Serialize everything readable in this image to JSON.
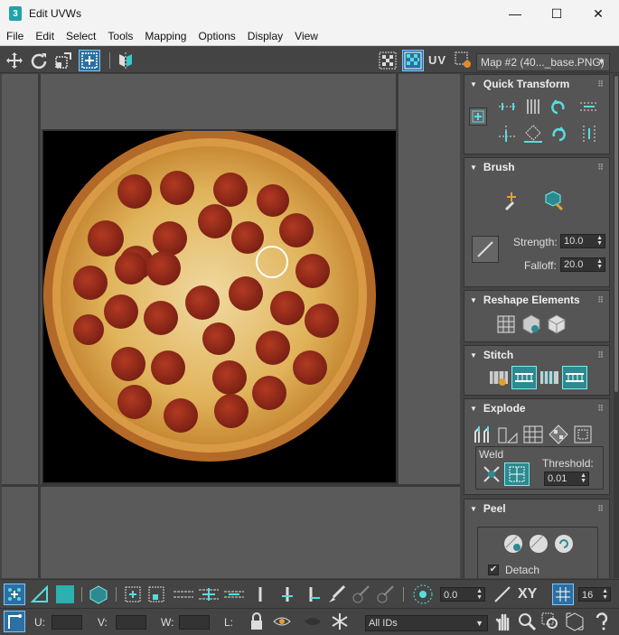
{
  "window": {
    "title": "Edit UVWs",
    "app_icon_text": "3",
    "minimize": "—",
    "maximize": "☐",
    "close": "✕"
  },
  "menu": [
    "File",
    "Edit",
    "Select",
    "Tools",
    "Mapping",
    "Options",
    "Display",
    "View"
  ],
  "toolbar": {
    "uv_label": "UV",
    "map_dropdown": "Map #2 (40..._base.PNG)"
  },
  "panel": {
    "quick_transform": "Quick Transform",
    "brush": {
      "title": "Brush",
      "strength_label": "Strength:",
      "strength_value": "10.0",
      "falloff_label": "Falloff:",
      "falloff_value": "20.0"
    },
    "reshape": "Reshape Elements",
    "stitch": "Stitch",
    "explode": {
      "title": "Explode",
      "weld_label": "Weld",
      "threshold_label": "Threshold:",
      "threshold_value": "0.01"
    },
    "peel": {
      "title": "Peel",
      "detach_label": "Detach",
      "detach_checked": "✔"
    }
  },
  "bottom": {
    "offset_value": "0.0",
    "xy_label": "XY",
    "grid_value": "16",
    "u_label": "U:",
    "v_label": "V:",
    "w_label": "W:",
    "l_label": "L:",
    "ids_dropdown": "All IDs"
  },
  "colors": {
    "accent": "#2c8a90",
    "active": "#2c6fa0",
    "pepperoni": "#9a2d1d",
    "cheese": "#e3b560"
  }
}
